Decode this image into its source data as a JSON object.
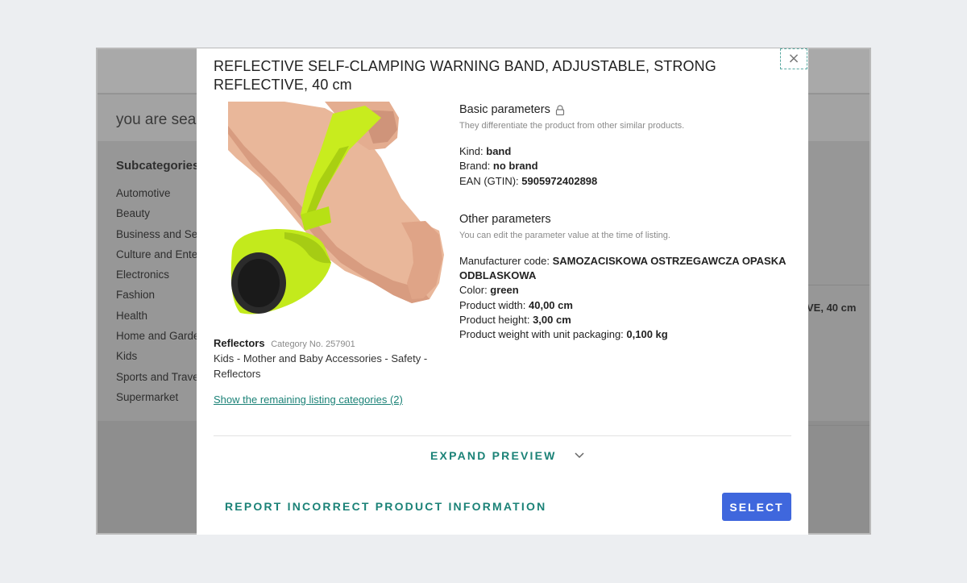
{
  "background": {
    "search_text": "you are sear",
    "subcategories_title": "Subcategories",
    "subcategories": [
      "Automotive",
      "Beauty",
      "Business and Serv",
      "Culture and Enter",
      "Electronics",
      "Fashion",
      "Health",
      "Home and Garden",
      "Kids",
      "Sports and Travel",
      "Supermarket"
    ],
    "right_text": "VE, 40 cm"
  },
  "modal": {
    "close_label": "×",
    "title": "REFLECTIVE SELF-CLAMPING WARNING BAND, ADJUSTABLE, STRONG REFLECTIVE, 40 cm",
    "image_icon": "reflective-band-product-photo",
    "category": {
      "name": "Reflectors",
      "number": "Category No. 257901",
      "path": "Kids - Mother and Baby Accessories - Safety - Reflectors",
      "link": "Show the remaining listing categories (2)"
    },
    "basic": {
      "title": "Basic parameters",
      "icon": "lock-icon",
      "subtitle": "They differentiate the product from other similar products.",
      "rows": [
        {
          "label": "Kind: ",
          "value": "band"
        },
        {
          "label": "Brand: ",
          "value": "no brand"
        },
        {
          "label": "EAN (GTIN): ",
          "value": "5905972402898"
        }
      ]
    },
    "other": {
      "title": "Other parameters",
      "subtitle": "You can edit the parameter value at the time of listing.",
      "rows": [
        {
          "label": "Manufacturer code: ",
          "value": "SAMOZACISKOWA OSTRZEGAWCZA OPASKA ODBLASKOWA"
        },
        {
          "label": "Color: ",
          "value": "green"
        },
        {
          "label": "Product width: ",
          "value": "40,00 cm"
        },
        {
          "label": "Product height: ",
          "value": "3,00 cm"
        },
        {
          "label": "Product weight with unit packaging: ",
          "value": "0,100 kg"
        }
      ]
    },
    "expand_label": "EXPAND PREVIEW",
    "report_label": "REPORT INCORRECT PRODUCT INFORMATION",
    "select_label": "SELECT",
    "accent_color": "#1b8277",
    "button_color": "#3f67dd"
  }
}
